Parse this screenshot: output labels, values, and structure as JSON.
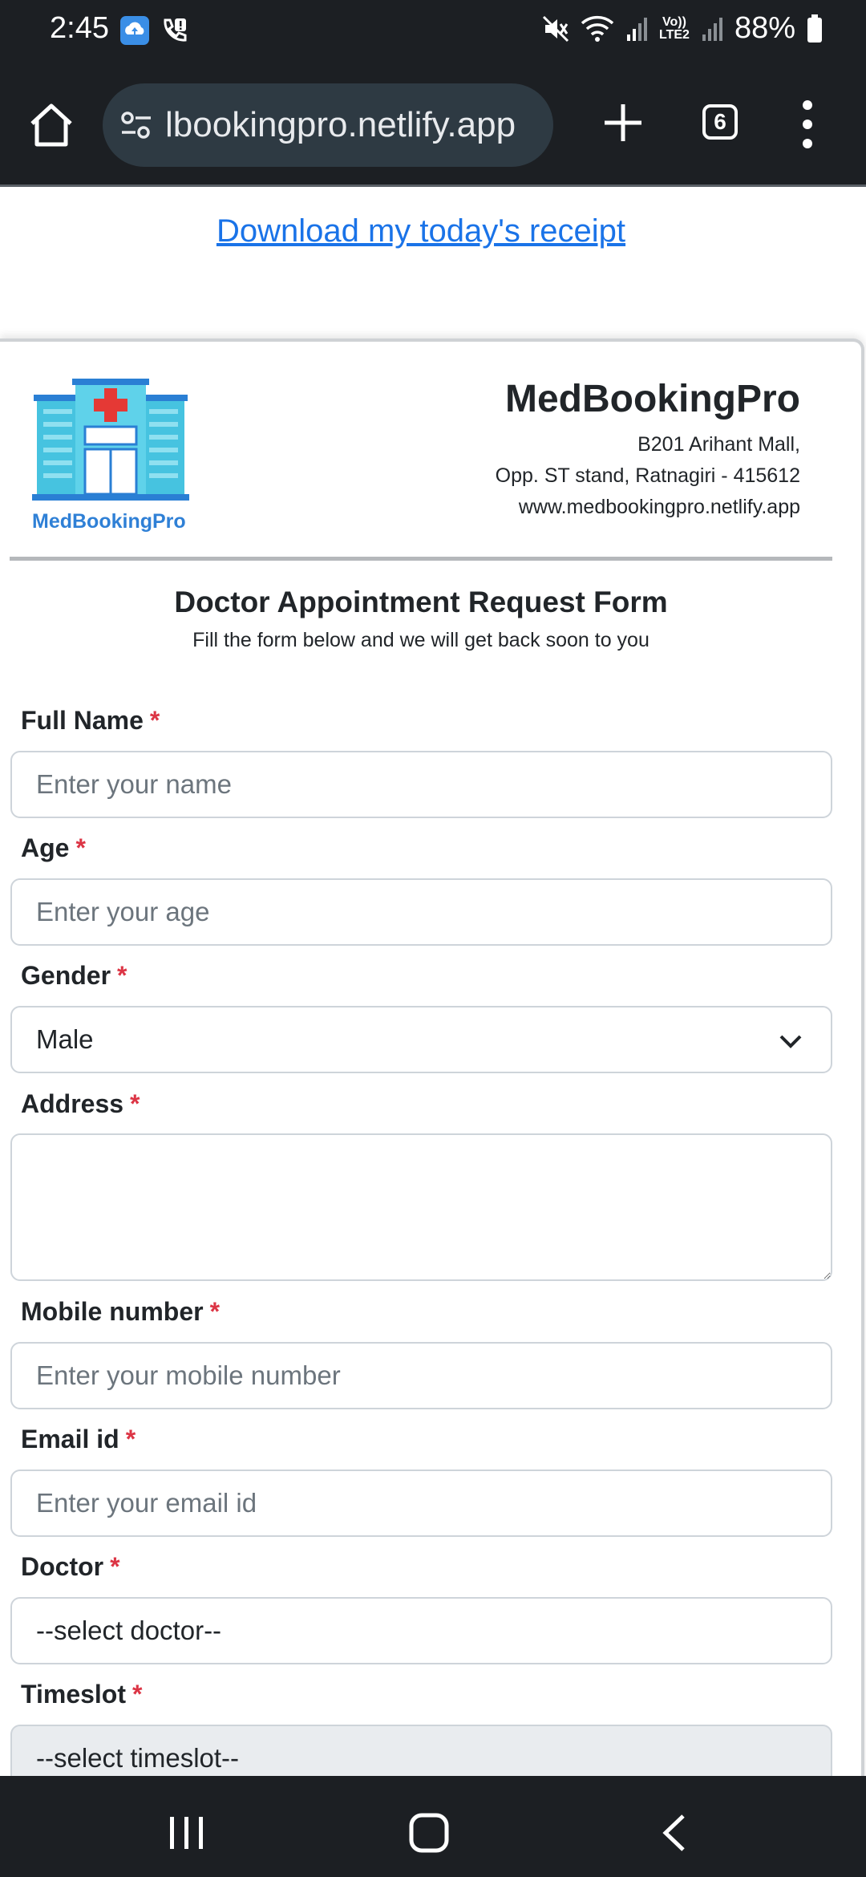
{
  "status_bar": {
    "time": "2:45",
    "volte_line1": "Vo))",
    "volte_line2": "LTE2",
    "battery": "88%"
  },
  "browser": {
    "url": "lbookingpro.netlify.app",
    "tab_count": "6"
  },
  "page": {
    "receipt_link": "Download my today's receipt",
    "brand": {
      "logo_caption": "MedBookingPro",
      "title": "MedBookingPro",
      "address_line1": "B201 Arihant Mall,",
      "address_line2": "Opp. ST stand, Ratnagiri - 415612",
      "website": "www.medbookingpro.netlify.app"
    },
    "form": {
      "title": "Doctor Appointment Request Form",
      "subtitle": "Fill the form below and we will get back soon to you",
      "required_mark": "*",
      "full_name": {
        "label": "Full Name",
        "placeholder": "Enter your name",
        "value": ""
      },
      "age": {
        "label": "Age",
        "placeholder": "Enter your age",
        "value": ""
      },
      "gender": {
        "label": "Gender",
        "value": "Male"
      },
      "address": {
        "label": "Address",
        "value": ""
      },
      "mobile": {
        "label": "Mobile number",
        "placeholder": "Enter your mobile number",
        "value": ""
      },
      "email": {
        "label": "Email id",
        "placeholder": "Enter your email id",
        "value": ""
      },
      "doctor": {
        "label": "Doctor",
        "value": "--select doctor--"
      },
      "timeslot": {
        "label": "Timeslot",
        "value": "--select timeslot--"
      }
    }
  },
  "colors": {
    "system_bar": "#1c1f23",
    "url_pill": "#2e3a43",
    "link": "#1a73e8",
    "required": "#dc3545",
    "logo_caption": "#2f80d6"
  },
  "icons": {
    "home": "home-icon",
    "site_settings": "tune-icon",
    "new_tab": "plus-icon",
    "menu": "more-vert-icon",
    "dropdown": "chevron-down-icon"
  }
}
